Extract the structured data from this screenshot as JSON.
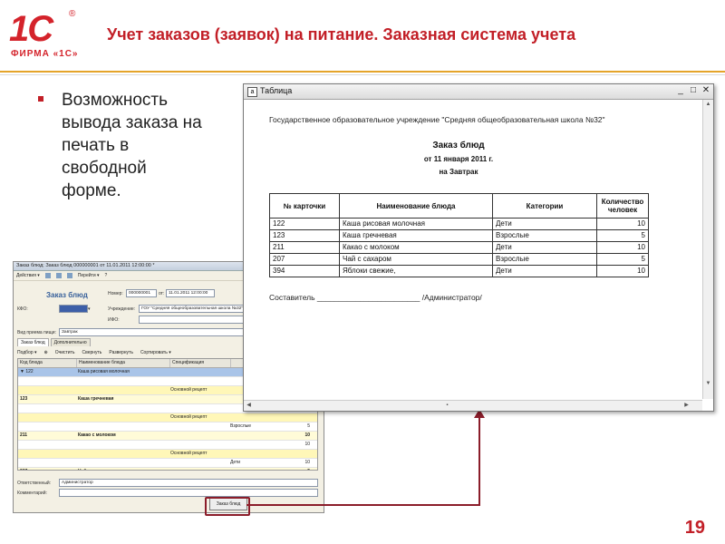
{
  "header": {
    "logo_mark": "1C",
    "logo_reg": "®",
    "logo_firm": "ФИРМА «1С»",
    "title": "Учет заказов (заявок) на питание. Заказная система учета"
  },
  "bullet": {
    "text": "Возможность\nвывода заказа на\nпечать в\nсвободной\nформе."
  },
  "form": {
    "window_title": "Заказ блюд: Заказ блюд 000000001 от 11.01.2011 12:00:00 *",
    "toolbar": [
      "Действия ▾",
      "Перейти ▾",
      "?"
    ],
    "doc_title": "Заказ блюд",
    "number_label": "Номер:",
    "number_value": "000000001",
    "date_label": "от:",
    "date_value": "11.01.2011 12:00:00",
    "kfo_label": "КФО:",
    "institution_label": "Учреждение:",
    "institution_value": "ГОУ \"Средняя общеобразовательная школа №32\"",
    "ifo_label": "ИФО:",
    "meal_type_label": "Вид приема пищи:",
    "meal_type_value": "Завтрак",
    "tabs": [
      "Заказ блюд",
      "Дополнительно"
    ],
    "grid_toolbar": [
      "Подбор ▾",
      "Очистить",
      "Свернуть",
      "Развернуть",
      "Сортировать ▾"
    ],
    "columns": [
      "Код блюда",
      "Наименование блюда",
      "Спецификация",
      "",
      ""
    ],
    "rows": [
      {
        "kind": "sel",
        "cells": [
          "▼ 122",
          "Каша рисовая молочная",
          "",
          "",
          ""
        ]
      },
      {
        "kind": "norm",
        "cells": [
          "",
          "",
          "",
          "",
          "10"
        ]
      },
      {
        "kind": "sub",
        "cells": [
          "",
          "",
          "Основной рецепт",
          "",
          ""
        ]
      },
      {
        "kind": "grp",
        "cells": [
          "123",
          "Каша гречневая",
          "",
          "",
          "5"
        ]
      },
      {
        "kind": "norm",
        "cells": [
          "",
          "",
          "",
          "",
          "5"
        ]
      },
      {
        "kind": "sub",
        "cells": [
          "",
          "",
          "Основной рецепт",
          "",
          ""
        ]
      },
      {
        "kind": "norm",
        "cells": [
          "",
          "",
          "",
          "Взрослые",
          "5"
        ]
      },
      {
        "kind": "grp",
        "cells": [
          "211",
          "Какао с молоком",
          "",
          "",
          "10"
        ]
      },
      {
        "kind": "norm",
        "cells": [
          "",
          "",
          "",
          "",
          "10"
        ]
      },
      {
        "kind": "sub",
        "cells": [
          "",
          "",
          "Основной рецепт",
          "",
          ""
        ]
      },
      {
        "kind": "norm",
        "cells": [
          "",
          "",
          "",
          "Дети",
          "10"
        ]
      },
      {
        "kind": "grp",
        "cells": [
          "207",
          "Чай с сахаром",
          "",
          "",
          "5"
        ]
      },
      {
        "kind": "sub",
        "cells": [
          "",
          "",
          "Основной рецепт",
          "",
          "5"
        ]
      }
    ],
    "responsible_label": "Ответственный:",
    "responsible_value": "Администратор",
    "comment_label": "Комментарий:",
    "order_button": "Заказ блюд"
  },
  "preview": {
    "window_title": "Таблица",
    "minimize": "_",
    "maximize": "□",
    "close": "✕",
    "org_line": "Государственное образовательное учреждение \"Средняя общеобразовательная школа №32\"",
    "doc_title": "Заказ блюд",
    "doc_date": "от 11 января 2011 г.",
    "doc_meal": "на Завтрак",
    "table": {
      "headers": [
        "№ карточки",
        "Наименование блюда",
        "Категории",
        "Количество человек"
      ],
      "rows": [
        [
          "122",
          "Каша рисовая молочная",
          "Дети",
          "10"
        ],
        [
          "123",
          "Каша гречневая",
          "Взрослые",
          "5"
        ],
        [
          "211",
          "Какао с молоком",
          "Дети",
          "10"
        ],
        [
          "207",
          "Чай с сахаром",
          "Взрослые",
          "5"
        ],
        [
          "394",
          "Яблоки свежие,",
          "Дети",
          "10"
        ]
      ]
    },
    "signature": "Составитель ________________________ /Администратор/"
  },
  "page_number": "19",
  "colors": {
    "brand_red": "#c21f27",
    "accent_line": "#e5a42a",
    "connector": "#8b1d2a"
  }
}
